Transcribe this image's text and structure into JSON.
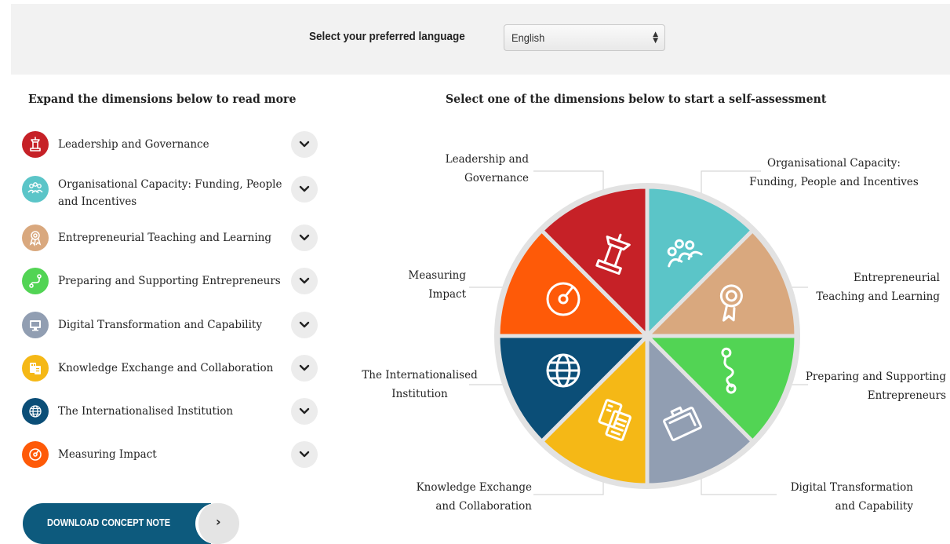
{
  "language_bar": {
    "label": "Select your preferred language",
    "selected": "English"
  },
  "left_heading": "Expand the dimensions below to read more",
  "right_heading": "Select one of the dimensions below to start a self-assessment",
  "dimensions": [
    {
      "label": "Leadership and Governance",
      "color": "#c62127",
      "icon": "podium-icon"
    },
    {
      "label": "Organisational Capacity: Funding, People and Incentives",
      "color": "#5bc5c8",
      "icon": "people-icon"
    },
    {
      "label": "Entrepreneurial Teaching and Learning",
      "color": "#d9a87e",
      "icon": "award-icon"
    },
    {
      "label": "Preparing and Supporting Entrepreneurs",
      "color": "#52d454",
      "icon": "route-icon"
    },
    {
      "label": "Digital Transformation and Capability",
      "color": "#919eb2",
      "icon": "monitor-icon"
    },
    {
      "label": "Knowledge Exchange and Collaboration",
      "color": "#f5b816",
      "icon": "documents-icon"
    },
    {
      "label": "The Internationalised Institution",
      "color": "#0b4e77",
      "icon": "globe-icon"
    },
    {
      "label": "Measuring Impact",
      "color": "#fe5a08",
      "icon": "gauge-icon"
    }
  ],
  "download_button": {
    "label": "DOWNLOAD CONCEPT NOTE",
    "arrow": "›"
  },
  "wheel_labels": {
    "leadership": [
      "Leadership and",
      "Governance"
    ],
    "organisational": [
      "Organisational Capacity:",
      "Funding, People and Incentives"
    ],
    "teaching": [
      "Entrepreneurial",
      "Teaching and Learning"
    ],
    "preparing": [
      "Preparing and Supporting",
      "Entrepreneurs"
    ],
    "digital": [
      "Digital Transformation",
      "and Capability"
    ],
    "knowledge": [
      "Knowledge Exchange",
      "and Collaboration"
    ],
    "international": [
      "The Internationalised",
      "Institution"
    ],
    "measuring": [
      "Measuring",
      "Impact"
    ]
  }
}
